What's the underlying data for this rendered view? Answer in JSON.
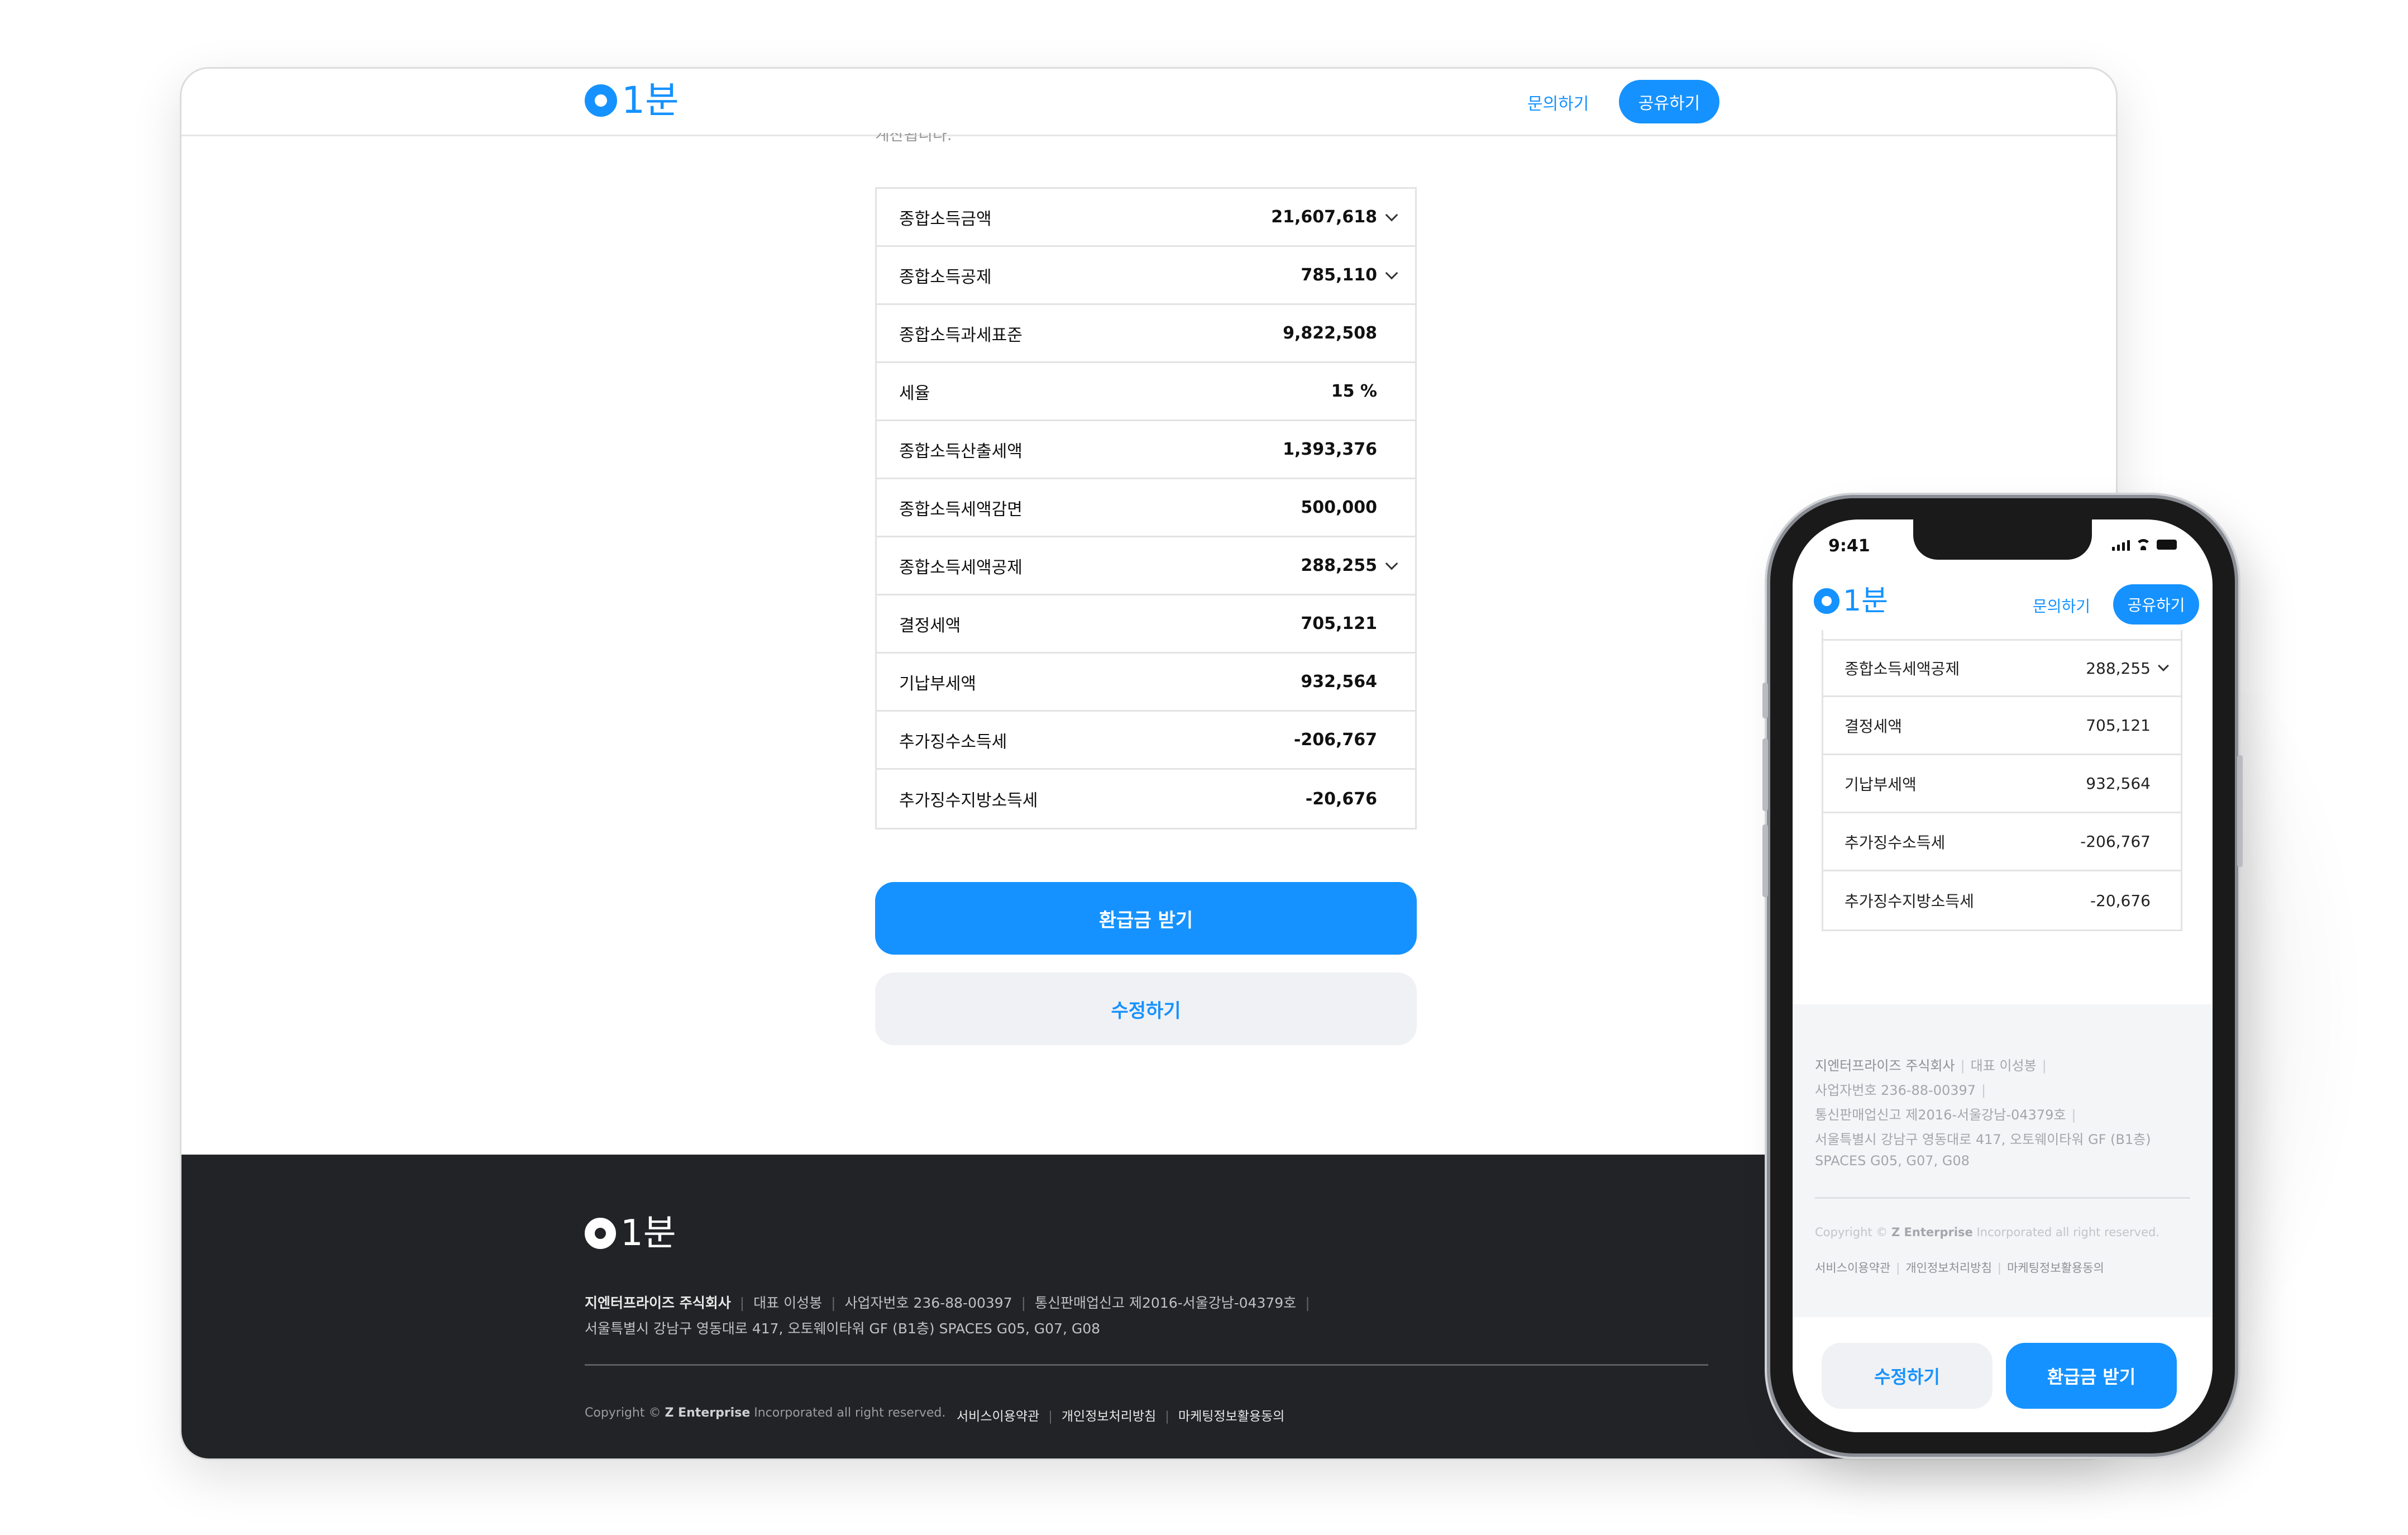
{
  "brand": {
    "logo_text": "1분",
    "accent": "#1592ff",
    "footer_bg": "#222326"
  },
  "header": {
    "inquire_label": "문의하기",
    "share_label": "공유하기"
  },
  "desktop": {
    "cut_off_text": "계산됩니다.",
    "rows": [
      {
        "label": "종합소득금액",
        "value": "21,607,618",
        "expandable": true
      },
      {
        "label": "종합소득공제",
        "value": "785,110",
        "expandable": true
      },
      {
        "label": "종합소득과세표준",
        "value": "9,822,508",
        "expandable": false
      },
      {
        "label": "세율",
        "value": "15 %",
        "expandable": false
      },
      {
        "label": "종합소득산출세액",
        "value": "1,393,376",
        "expandable": false
      },
      {
        "label": "종합소득세액감면",
        "value": "500,000",
        "expandable": false
      },
      {
        "label": "종합소득세액공제",
        "value": "288,255",
        "expandable": true
      },
      {
        "label": "결정세액",
        "value": "705,121",
        "expandable": false
      },
      {
        "label": "기납부세액",
        "value": "932,564",
        "expandable": false
      },
      {
        "label": "추가징수소득세",
        "value": "-206,767",
        "expandable": false
      },
      {
        "label": "추가징수지방소득세",
        "value": "-20,676",
        "expandable": false
      }
    ],
    "primary_button": "환급금 받기",
    "secondary_button": "수정하기"
  },
  "footer": {
    "company": "지엔터프라이즈 주식회사",
    "ceo": "대표 이성봉",
    "biz_no": "사업자번호 236-88-00397",
    "mail_order": "통신판매업신고 제2016-서울강남-04379호",
    "address": "서울특별시 강남구 영동대로 417, 오토웨이타워 GF (B1층)",
    "address_suffix": "SPACES G05, G07, G08",
    "copyright_prefix": "Copyright ©",
    "copyright_company": "Z Enterprise",
    "copyright_suffix": "Incorporated all right reserved.",
    "links": [
      "서비스이용약관",
      "개인정보처리방침",
      "마케팅정보활용동의"
    ]
  },
  "phone": {
    "time": "9:41",
    "rows": [
      {
        "label": "종합소득세액공제",
        "value": "288,255",
        "expandable": true
      },
      {
        "label": "결정세액",
        "value": "705,121",
        "expandable": false
      },
      {
        "label": "기납부세액",
        "value": "932,564",
        "expandable": false
      },
      {
        "label": "추가징수소득세",
        "value": "-206,767",
        "expandable": false
      },
      {
        "label": "추가징수지방소득세",
        "value": "-20,676",
        "expandable": false
      }
    ],
    "secondary_button": "수정하기",
    "primary_button": "환급금 받기"
  }
}
